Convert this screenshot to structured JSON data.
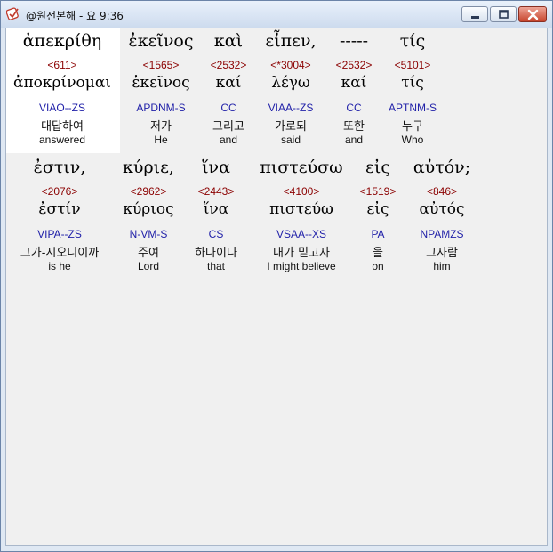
{
  "window": {
    "title": "@원전본해 - 요 9:36"
  },
  "rows": [
    {
      "words": [
        {
          "greek": "ἀπεκρίθη",
          "strong": "<611>",
          "lemma": "ἀποκρίνομαι",
          "morph": "VIAO--ZS",
          "korean": "대답하여",
          "english": "answered"
        },
        {
          "greek": "ἐκεῖνος",
          "strong": "<1565>",
          "lemma": "ἐκεῖνος",
          "morph": "APDNM-S",
          "korean": "저가",
          "english": "He"
        },
        {
          "greek": "καὶ",
          "strong": "<2532>",
          "lemma": "καί",
          "morph": "CC",
          "korean": "그리고",
          "english": "and"
        },
        {
          "greek": "εἶπεν,",
          "strong": "<*3004>",
          "lemma": "λέγω",
          "morph": "VIAA--ZS",
          "korean": "가로되",
          "english": "said"
        },
        {
          "greek": "-----",
          "strong": "<2532>",
          "lemma": "καί",
          "morph": "CC",
          "korean": "또한",
          "english": "and"
        },
        {
          "greek": "τίς",
          "strong": "<5101>",
          "lemma": "τίς",
          "morph": "APTNM-S",
          "korean": "누구",
          "english": "Who"
        }
      ]
    },
    {
      "words": [
        {
          "greek": "ἐστιν,",
          "strong": "<2076>",
          "lemma": "ἐστίν",
          "morph": "VIPA--ZS",
          "korean": "그가-시오니이까",
          "english": "is he"
        },
        {
          "greek": "κύριε,",
          "strong": "<2962>",
          "lemma": "κύριος",
          "morph": "N-VM-S",
          "korean": "주여",
          "english": "Lord"
        },
        {
          "greek": "ἵνα",
          "strong": "<2443>",
          "lemma": "ἵνα",
          "morph": "CS",
          "korean": "하나이다",
          "english": "that"
        },
        {
          "greek": "πιστεύσω",
          "strong": "<4100>",
          "lemma": "πιστεύω",
          "morph": "VSAA--XS",
          "korean": "내가 믿고자",
          "english": "I might believe"
        },
        {
          "greek": "εἰς",
          "strong": "<1519>",
          "lemma": "εἰς",
          "morph": "PA",
          "korean": "을",
          "english": "on"
        },
        {
          "greek": "αὐτόν;",
          "strong": "<846>",
          "lemma": "αὐτός",
          "morph": "NPAMZS",
          "korean": "그사람",
          "english": "him"
        }
      ]
    }
  ]
}
